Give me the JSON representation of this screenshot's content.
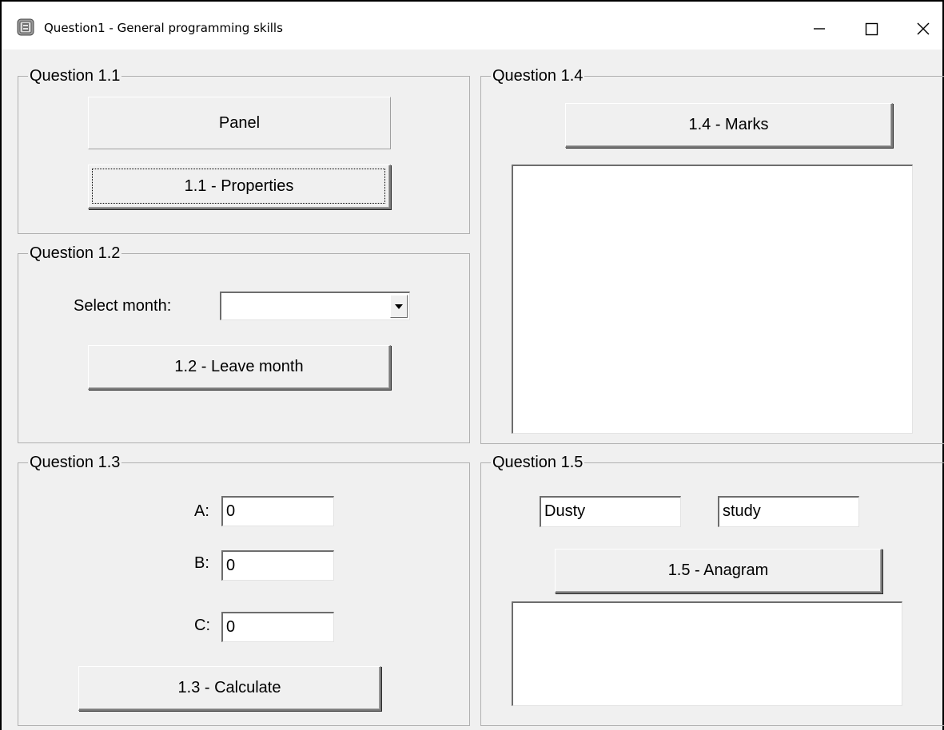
{
  "window": {
    "title": "Question1 - General programming skills"
  },
  "caption_buttons": {
    "minimize_icon": "minimize-icon",
    "maximize_icon": "maximize-icon",
    "close_icon": "close-icon"
  },
  "q11": {
    "legend": "Question 1.1",
    "panel_text": "Panel",
    "properties_button": "1.1 - Properties"
  },
  "q12": {
    "legend": "Question 1.2",
    "select_month_label": "Select month:",
    "month_value": "",
    "leave_month_button": "1.2 - Leave month"
  },
  "q13": {
    "legend": "Question 1.3",
    "a_label": "A:",
    "a_value": "0",
    "b_label": "B:",
    "b_value": "0",
    "c_label": "C:",
    "c_value": "0",
    "calculate_button": "1.3 - Calculate"
  },
  "q14": {
    "legend": "Question 1.4",
    "marks_button": "1.4 - Marks",
    "output": ""
  },
  "q15": {
    "legend": "Question 1.5",
    "word1_value": "Dusty",
    "word2_value": "study",
    "anagram_button": "1.5 - Anagram",
    "output": ""
  }
}
